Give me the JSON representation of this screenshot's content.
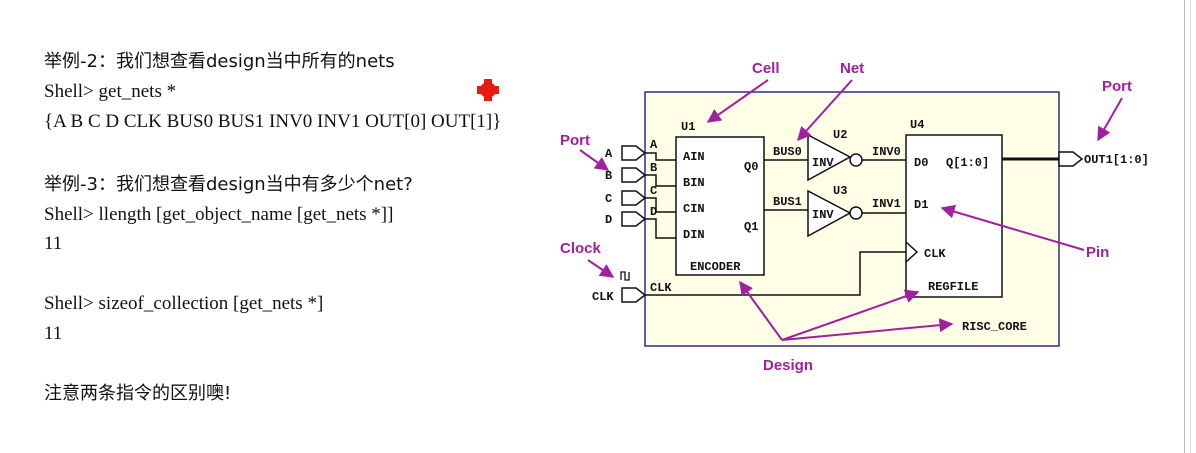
{
  "text_lines": [
    {
      "id": "ex2-title",
      "text": "举例-2：我们想查看design当中所有的nets"
    },
    {
      "id": "ex2-cmd",
      "text": "Shell> get_nets *"
    },
    {
      "id": "ex2-out",
      "text": "{A B C D CLK BUS0 BUS1 INV0 INV1 OUT[0] OUT[1]}"
    },
    {
      "id": "ex3-title",
      "text": "举例-3：我们想查看design当中有多少个net?"
    },
    {
      "id": "ex3-cmd",
      "text": "Shell> llength [get_object_name [get_nets *]]"
    },
    {
      "id": "ex3-out",
      "text": "11"
    },
    {
      "id": "ex4-cmd",
      "text": "Shell> sizeof_collection [get_nets *]"
    },
    {
      "id": "ex4-out",
      "text": "11"
    },
    {
      "id": "note",
      "text": "注意两条指令的区别噢!"
    }
  ],
  "diagram": {
    "callouts": {
      "cell": "Cell",
      "net": "Net",
      "port_left": "Port",
      "port_right": "Port",
      "clock": "Clock",
      "pin": "Pin",
      "design": "Design"
    },
    "instances": {
      "u1": "U1",
      "u2": "U2",
      "u3": "U3",
      "u4": "U4"
    },
    "encoder": {
      "name": "ENCODER",
      "inputs": [
        "AIN",
        "BIN",
        "CIN",
        "DIN"
      ],
      "outputs": [
        "Q0",
        "Q1"
      ]
    },
    "inverters": [
      "INV",
      "INV"
    ],
    "regfile": {
      "name": "REGFILE",
      "pins": [
        "D0",
        "Q[1:0]",
        "D1",
        "CLK"
      ]
    },
    "ports": [
      "A",
      "B",
      "C",
      "D",
      "CLK"
    ],
    "nets": [
      "A",
      "B",
      "C",
      "D",
      "CLK",
      "BUS0",
      "BUS1",
      "INV0",
      "INV1"
    ],
    "output_port": "OUT1[1:0]",
    "design_name": "RISC_CORE",
    "colors": {
      "callout": "#a020a0",
      "design_fill": "#ffffe8",
      "design_border": "#2b2b8a",
      "red_dot": "#e8190f"
    }
  }
}
